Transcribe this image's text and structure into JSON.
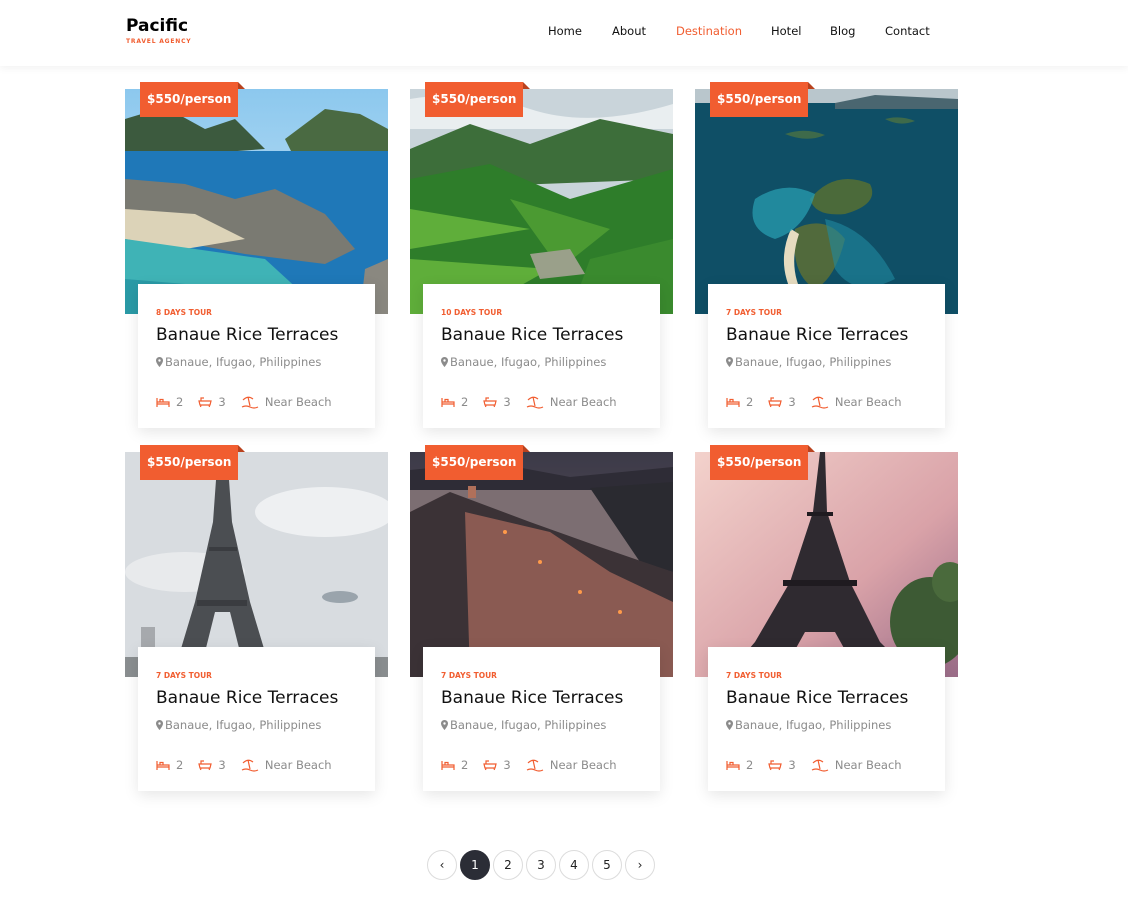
{
  "brand": {
    "name": "Pacific",
    "tagline": "TRAVEL AGENCY",
    "accent": "#f15d30"
  },
  "nav": [
    {
      "label": "Home",
      "active": false
    },
    {
      "label": "About",
      "active": false
    },
    {
      "label": "Destination",
      "active": true
    },
    {
      "label": "Hotel",
      "active": false
    },
    {
      "label": "Blog",
      "active": false
    },
    {
      "label": "Contact",
      "active": false
    }
  ],
  "cards": [
    {
      "price": "$550/person",
      "days": "8 DAYS TOUR",
      "title": "Banaue Rice Terraces",
      "location": "Banaue, Ifugao, Philippines",
      "beds": "2",
      "baths": "3",
      "feature": "Near Beach",
      "image": "tropical-lagoon-photo"
    },
    {
      "price": "$550/person",
      "days": "10 DAYS TOUR",
      "title": "Banaue Rice Terraces",
      "location": "Banaue, Ifugao, Philippines",
      "beds": "2",
      "baths": "3",
      "feature": "Near Beach",
      "image": "rice-terraces-photo"
    },
    {
      "price": "$550/person",
      "days": "7 DAYS TOUR",
      "title": "Banaue Rice Terraces",
      "location": "Banaue, Ifugao, Philippines",
      "beds": "2",
      "baths": "3",
      "feature": "Near Beach",
      "image": "island-aerial-photo"
    },
    {
      "price": "$550/person",
      "days": "7 DAYS TOUR",
      "title": "Banaue Rice Terraces",
      "location": "Banaue, Ifugao, Philippines",
      "beds": "2",
      "baths": "3",
      "feature": "Near Beach",
      "image": "eiffel-tower-cloudy-photo"
    },
    {
      "price": "$550/person",
      "days": "7 DAYS TOUR",
      "title": "Banaue Rice Terraces",
      "location": "Banaue, Ifugao, Philippines",
      "beds": "2",
      "baths": "3",
      "feature": "Near Beach",
      "image": "cliffside-village-photo"
    },
    {
      "price": "$550/person",
      "days": "7 DAYS TOUR",
      "title": "Banaue Rice Terraces",
      "location": "Banaue, Ifugao, Philippines",
      "beds": "2",
      "baths": "3",
      "feature": "Near Beach",
      "image": "eiffel-tower-sunset-photo"
    }
  ],
  "pagination": {
    "prev": "‹",
    "pages": [
      "1",
      "2",
      "3",
      "4",
      "5"
    ],
    "current": "1",
    "next": "›"
  }
}
